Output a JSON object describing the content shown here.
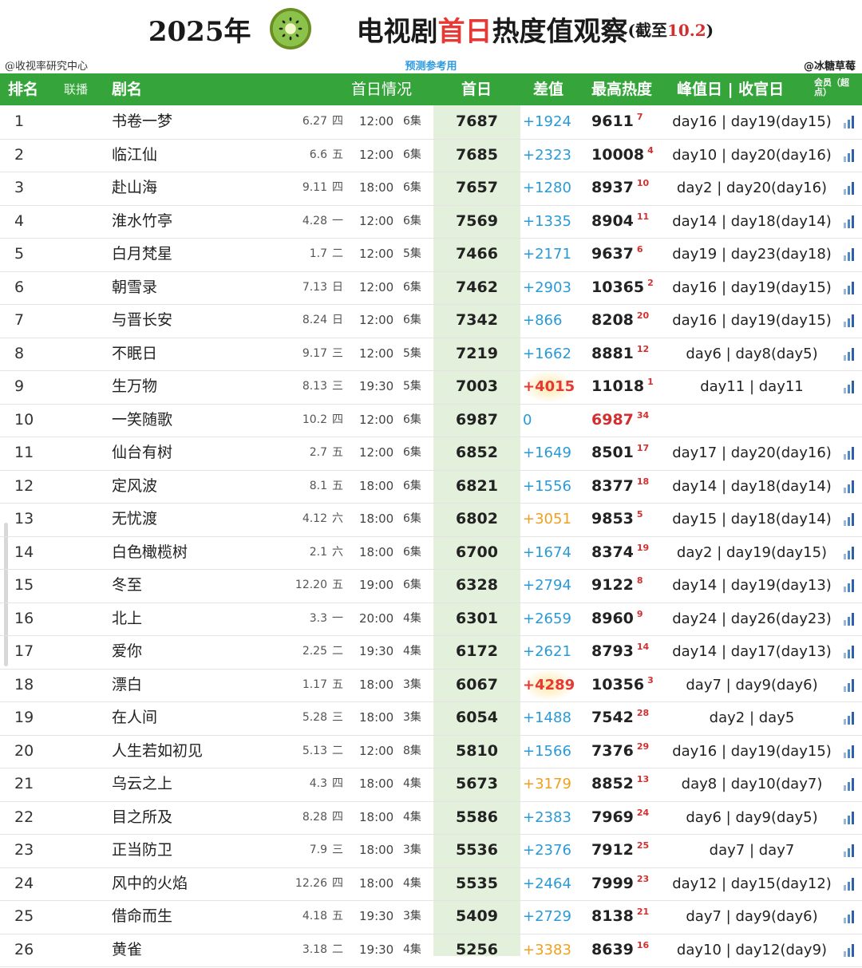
{
  "title": {
    "year": "2025年",
    "part1": "电视剧",
    "highlight": "首日",
    "part2": "热度值观察",
    "note_prefix": "(截至",
    "note_date": "10.2",
    "note_suffix": ")"
  },
  "subheader": {
    "left": "@收视率研究中心",
    "center": "预测参考用",
    "right": "@冰糖草莓"
  },
  "columns": {
    "rank": "排名",
    "broadcast": "联播",
    "name": "剧名",
    "first_info": "首日情况",
    "first": "首日",
    "diff": "差值",
    "peak": "最高热度",
    "days": "峰值日 | 收官日",
    "member_note": "会员（超点）"
  },
  "colors": {
    "header_green": "#35a53b",
    "highlight_col": "#e3f1dc",
    "diff_blue": "#2a9ad6",
    "diff_orange": "#f0a01e",
    "diff_red": "#e53935",
    "rank_red": "#d32f2f"
  },
  "icon": "bar-signal-icon",
  "rows": [
    {
      "rank": "1",
      "name": "书卷一梦",
      "date": "6.27",
      "weekday": "四",
      "time": "12:00",
      "episodes": "6集",
      "first": "7687",
      "diff": "+1924",
      "diff_color": "blue",
      "peak": "9611",
      "peak_rank": "7",
      "days": "day16 | day19(day15)",
      "icon": true
    },
    {
      "rank": "2",
      "name": "临江仙",
      "date": "6.6",
      "weekday": "五",
      "time": "12:00",
      "episodes": "6集",
      "first": "7685",
      "diff": "+2323",
      "diff_color": "blue",
      "peak": "10008",
      "peak_rank": "4",
      "days": "day10 | day20(day16)",
      "icon": true
    },
    {
      "rank": "3",
      "name": "赴山海",
      "date": "9.11",
      "weekday": "四",
      "time": "18:00",
      "episodes": "6集",
      "first": "7657",
      "diff": "+1280",
      "diff_color": "blue",
      "peak": "8937",
      "peak_rank": "10",
      "days": "day2 | day20(day16)",
      "icon": true
    },
    {
      "rank": "4",
      "name": "淮水竹亭",
      "date": "4.28",
      "weekday": "一",
      "time": "12:00",
      "episodes": "6集",
      "first": "7569",
      "diff": "+1335",
      "diff_color": "blue",
      "peak": "8904",
      "peak_rank": "11",
      "days": "day14 | day18(day14)",
      "icon": true
    },
    {
      "rank": "5",
      "name": "白月梵星",
      "date": "1.7",
      "weekday": "二",
      "time": "12:00",
      "episodes": "5集",
      "first": "7466",
      "diff": "+2171",
      "diff_color": "blue",
      "peak": "9637",
      "peak_rank": "6",
      "days": "day19 | day23(day18)",
      "icon": true
    },
    {
      "rank": "6",
      "name": "朝雪录",
      "date": "7.13",
      "weekday": "日",
      "time": "12:00",
      "episodes": "6集",
      "first": "7462",
      "diff": "+2903",
      "diff_color": "blue",
      "peak": "10365",
      "peak_rank": "2",
      "days": "day16 | day19(day15)",
      "icon": true
    },
    {
      "rank": "7",
      "name": "与晋长安",
      "date": "8.24",
      "weekday": "日",
      "time": "12:00",
      "episodes": "6集",
      "first": "7342",
      "diff": "+866",
      "diff_color": "blue",
      "peak": "8208",
      "peak_rank": "20",
      "days": "day16 | day19(day15)",
      "icon": true
    },
    {
      "rank": "8",
      "name": "不眠日",
      "date": "9.17",
      "weekday": "三",
      "time": "12:00",
      "episodes": "5集",
      "first": "7219",
      "diff": "+1662",
      "diff_color": "blue",
      "peak": "8881",
      "peak_rank": "12",
      "days": "day6 | day8(day5)",
      "icon": true
    },
    {
      "rank": "9",
      "name": "生万物",
      "date": "8.13",
      "weekday": "三",
      "time": "19:30",
      "episodes": "5集",
      "first": "7003",
      "diff": "+4015",
      "diff_color": "red",
      "peak": "11018",
      "peak_rank": "1",
      "days": "day11 | day11",
      "icon": true
    },
    {
      "rank": "10",
      "name": "一笑随歌",
      "date": "10.2",
      "weekday": "四",
      "time": "12:00",
      "episodes": "6集",
      "first": "6987",
      "diff": "0",
      "diff_color": "blue",
      "peak": "6987",
      "peak_rank": "34",
      "peak_red": true,
      "days": "",
      "icon": false
    },
    {
      "rank": "11",
      "name": "仙台有树",
      "date": "2.7",
      "weekday": "五",
      "time": "12:00",
      "episodes": "6集",
      "first": "6852",
      "diff": "+1649",
      "diff_color": "blue",
      "peak": "8501",
      "peak_rank": "17",
      "days": "day17 | day20(day16)",
      "icon": true
    },
    {
      "rank": "12",
      "name": "定风波",
      "date": "8.1",
      "weekday": "五",
      "time": "18:00",
      "episodes": "6集",
      "first": "6821",
      "diff": "+1556",
      "diff_color": "blue",
      "peak": "8377",
      "peak_rank": "18",
      "days": "day14 | day18(day14)",
      "icon": true
    },
    {
      "rank": "13",
      "name": "无忧渡",
      "date": "4.12",
      "weekday": "六",
      "time": "18:00",
      "episodes": "6集",
      "first": "6802",
      "diff": "+3051",
      "diff_color": "orange",
      "peak": "9853",
      "peak_rank": "5",
      "days": "day15 | day18(day14)",
      "icon": true
    },
    {
      "rank": "14",
      "name": "白色橄榄树",
      "date": "2.1",
      "weekday": "六",
      "time": "18:00",
      "episodes": "6集",
      "first": "6700",
      "diff": "+1674",
      "diff_color": "blue",
      "peak": "8374",
      "peak_rank": "19",
      "days": "day2 | day19(day15)",
      "icon": true
    },
    {
      "rank": "15",
      "name": "冬至",
      "date": "12.20",
      "weekday": "五",
      "time": "19:00",
      "episodes": "6集",
      "first": "6328",
      "diff": "+2794",
      "diff_color": "blue",
      "peak": "9122",
      "peak_rank": "8",
      "days": "day14 | day19(day13)",
      "icon": true
    },
    {
      "rank": "16",
      "name": "北上",
      "date": "3.3",
      "weekday": "一",
      "time": "20:00",
      "episodes": "4集",
      "first": "6301",
      "diff": "+2659",
      "diff_color": "blue",
      "peak": "8960",
      "peak_rank": "9",
      "days": "day24 | day26(day23)",
      "icon": true
    },
    {
      "rank": "17",
      "name": "爱你",
      "date": "2.25",
      "weekday": "二",
      "time": "19:30",
      "episodes": "4集",
      "first": "6172",
      "diff": "+2621",
      "diff_color": "blue",
      "peak": "8793",
      "peak_rank": "14",
      "days": "day14 | day17(day13)",
      "icon": true
    },
    {
      "rank": "18",
      "name": "漂白",
      "date": "1.17",
      "weekday": "五",
      "time": "18:00",
      "episodes": "3集",
      "first": "6067",
      "diff": "+4289",
      "diff_color": "red",
      "peak": "10356",
      "peak_rank": "3",
      "days": "day7 | day9(day6)",
      "icon": true
    },
    {
      "rank": "19",
      "name": "在人间",
      "date": "5.28",
      "weekday": "三",
      "time": "18:00",
      "episodes": "3集",
      "first": "6054",
      "diff": "+1488",
      "diff_color": "blue",
      "peak": "7542",
      "peak_rank": "28",
      "days": "day2 | day5",
      "icon": true
    },
    {
      "rank": "20",
      "name": "人生若如初见",
      "date": "5.13",
      "weekday": "二",
      "time": "12:00",
      "episodes": "8集",
      "first": "5810",
      "diff": "+1566",
      "diff_color": "blue",
      "peak": "7376",
      "peak_rank": "29",
      "days": "day16 | day19(day15)",
      "icon": true
    },
    {
      "rank": "21",
      "name": "乌云之上",
      "date": "4.3",
      "weekday": "四",
      "time": "18:00",
      "episodes": "4集",
      "first": "5673",
      "diff": "+3179",
      "diff_color": "orange",
      "peak": "8852",
      "peak_rank": "13",
      "days": "day8 | day10(day7)",
      "icon": true
    },
    {
      "rank": "22",
      "name": "目之所及",
      "date": "8.28",
      "weekday": "四",
      "time": "18:00",
      "episodes": "4集",
      "first": "5586",
      "diff": "+2383",
      "diff_color": "blue",
      "peak": "7969",
      "peak_rank": "24",
      "days": "day6 | day9(day5)",
      "icon": true
    },
    {
      "rank": "23",
      "name": "正当防卫",
      "date": "7.9",
      "weekday": "三",
      "time": "18:00",
      "episodes": "3集",
      "first": "5536",
      "diff": "+2376",
      "diff_color": "blue",
      "peak": "7912",
      "peak_rank": "25",
      "days": "day7 | day7",
      "icon": true
    },
    {
      "rank": "24",
      "name": "风中的火焰",
      "date": "12.26",
      "weekday": "四",
      "time": "18:00",
      "episodes": "4集",
      "first": "5535",
      "diff": "+2464",
      "diff_color": "blue",
      "peak": "7999",
      "peak_rank": "23",
      "days": "day12 | day15(day12)",
      "icon": true
    },
    {
      "rank": "25",
      "name": "借命而生",
      "date": "4.18",
      "weekday": "五",
      "time": "19:30",
      "episodes": "3集",
      "first": "5409",
      "diff": "+2729",
      "diff_color": "blue",
      "peak": "8138",
      "peak_rank": "21",
      "days": "day7 | day9(day6)",
      "icon": true
    },
    {
      "rank": "26",
      "name": "黄雀",
      "date": "3.18",
      "weekday": "二",
      "time": "19:30",
      "episodes": "4集",
      "first": "5256",
      "diff": "+3383",
      "diff_color": "orange",
      "peak": "8639",
      "peak_rank": "16",
      "days": "day10 | day12(day9)",
      "icon": true
    }
  ]
}
